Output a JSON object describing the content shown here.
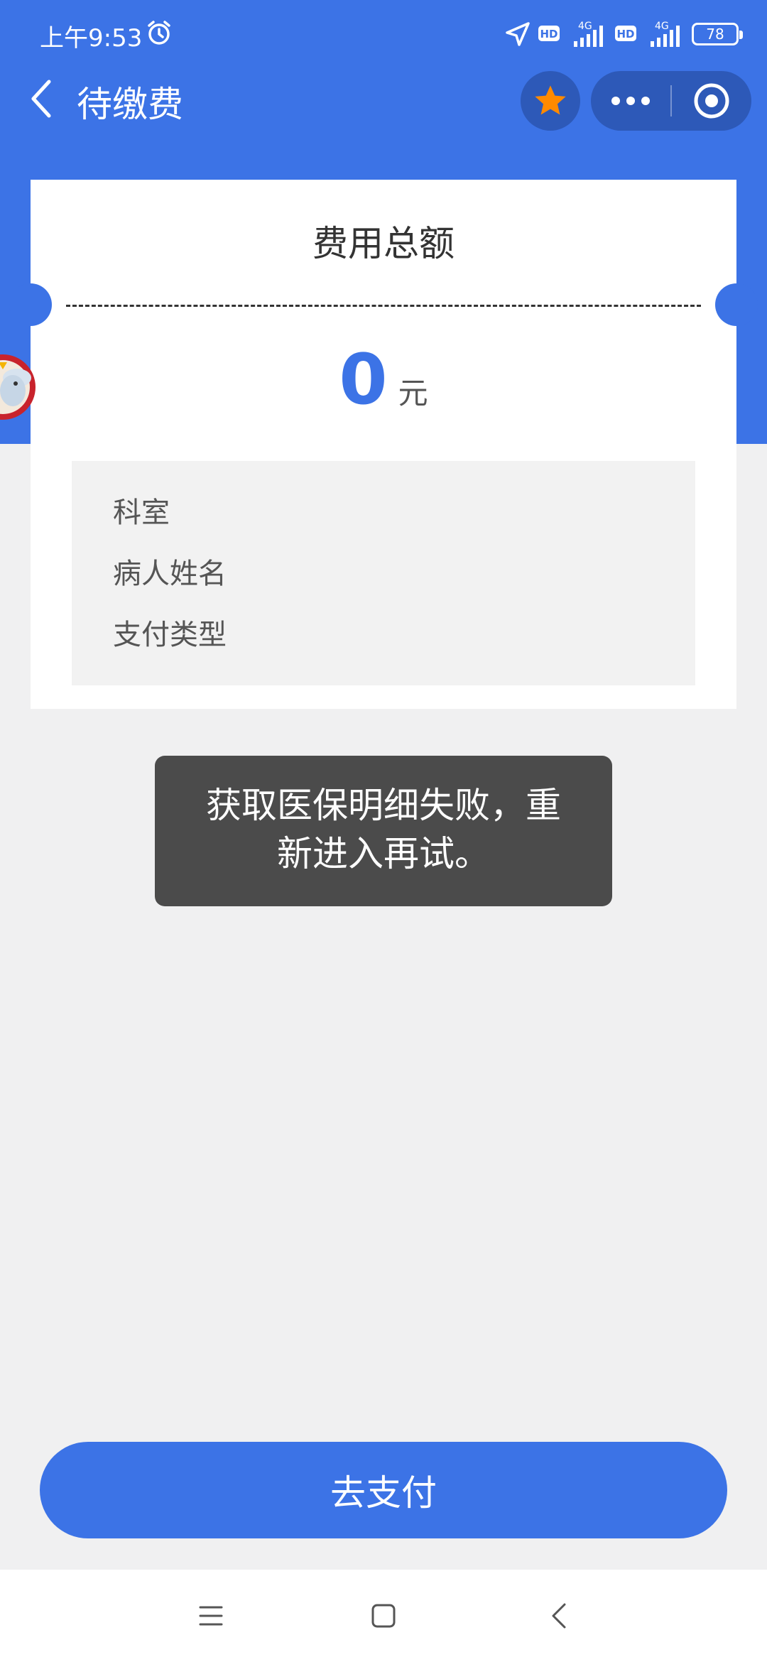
{
  "status_bar": {
    "time": "上午9:53",
    "battery": "78",
    "network_1": "4G",
    "network_2": "4G",
    "hd_1": "HD",
    "hd_2": "HD"
  },
  "nav": {
    "title": "待缴费"
  },
  "card": {
    "title": "费用总额",
    "amount_value": "0",
    "amount_unit": "元",
    "rows": [
      "科室",
      "病人姓名",
      "支付类型"
    ]
  },
  "toast": {
    "message": "获取医保明细失败，重新进入再试。"
  },
  "actions": {
    "pay_label": "去支付"
  },
  "colors": {
    "primary": "#3c73e6",
    "star": "#ff8a00",
    "toast_bg": "#4b4b4b"
  },
  "icons": [
    "back-arrow-icon",
    "star-icon",
    "more-icon",
    "close-target-icon",
    "alarm-icon",
    "location-icon",
    "signal-icon",
    "menu-icon",
    "home-icon",
    "back-icon"
  ]
}
